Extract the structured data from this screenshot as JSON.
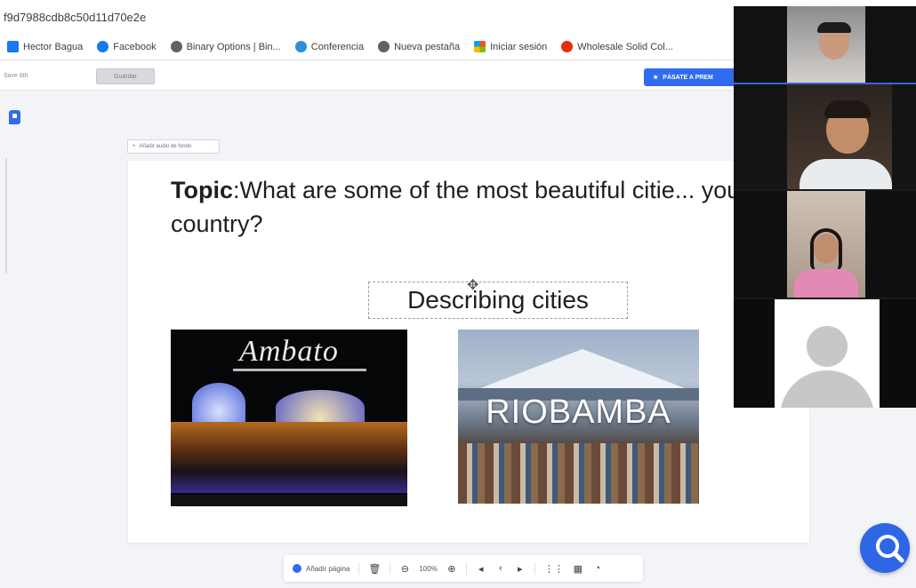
{
  "browser": {
    "url": "f9d7988cdb8c50d11d70e2e",
    "bookmarks": [
      {
        "label": "Hector Bagua",
        "icon": "facebook-square-icon",
        "color": "#1877f2"
      },
      {
        "label": "Facebook",
        "icon": "facebook-icon",
        "color": "#1877f2"
      },
      {
        "label": "Binary Options | Bin...",
        "icon": "globe-icon",
        "color": "#5f6368"
      },
      {
        "label": "Conferencia",
        "icon": "conference-icon",
        "color": "#2f8fd8"
      },
      {
        "label": "Nueva pestaña",
        "icon": "globe-icon",
        "color": "#5f6368"
      },
      {
        "label": "Iniciar sesión",
        "icon": "microsoft-icon",
        "color": "#f25022"
      },
      {
        "label": "Wholesale Solid Col...",
        "icon": "aliexpress-icon",
        "color": "#e62e04"
      }
    ]
  },
  "toolbar": {
    "input_value": "Save 8th",
    "button_label": "Guardar",
    "premium_label": "PÁSATE A PREM"
  },
  "editor": {
    "background_chip": "Añadir audio de fondo",
    "slide": {
      "topic_bold": "Topic",
      "topic_text": ":What are some of the most beautiful citie... your country?",
      "subtitle": "Describing cities",
      "image1_title": "Ambato",
      "image2_title": "RIOBAMBA"
    }
  },
  "bottom_toolbar": {
    "add_page": "Añadir página",
    "zoom": "100%"
  },
  "colors": {
    "accent": "#2f6cf0",
    "fab": "#2f66e6"
  }
}
